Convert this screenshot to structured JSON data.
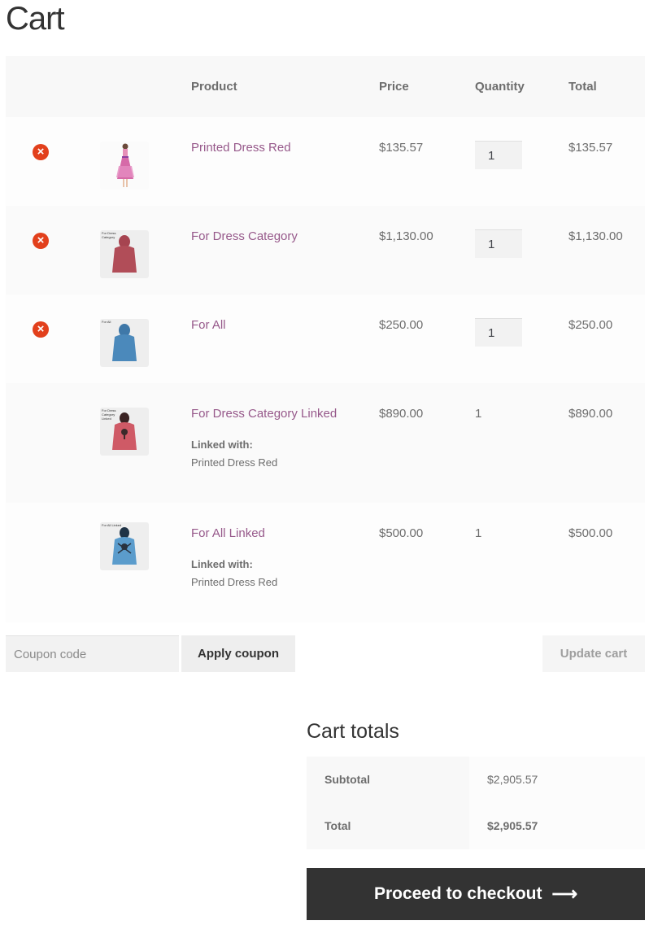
{
  "page": {
    "title": "Cart"
  },
  "colors": {
    "link": "#96588a",
    "remove": "#e2401c",
    "checkout_bg": "#333333"
  },
  "table": {
    "headers": {
      "product": "Product",
      "price": "Price",
      "quantity": "Quantity",
      "total": "Total"
    },
    "rows": [
      {
        "name": "Printed Dress Red",
        "price": "$135.57",
        "quantity": "1",
        "total": "$135.57",
        "removable": true,
        "image": "dress-pink",
        "image_label": ""
      },
      {
        "name": "For Dress Category",
        "price": "$1,130.00",
        "quantity": "1",
        "total": "$1,130.00",
        "removable": true,
        "image": "hoodie-red-back",
        "image_label": "For Dress Category"
      },
      {
        "name": "For All",
        "price": "$250.00",
        "quantity": "1",
        "total": "$250.00",
        "removable": true,
        "image": "hoodie-blue-back",
        "image_label": "For All"
      },
      {
        "name": "For Dress Category Linked",
        "price": "$890.00",
        "quantity": "1",
        "total": "$890.00",
        "removable": false,
        "image": "hoodie-red-front",
        "image_label": "For Dress Category Linked",
        "linked_label": "Linked with:",
        "linked_value": "Printed Dress Red"
      },
      {
        "name": "For All Linked",
        "price": "$500.00",
        "quantity": "1",
        "total": "$500.00",
        "removable": false,
        "image": "hoodie-blue-front",
        "image_label": "For All Linked",
        "linked_label": "Linked with:",
        "linked_value": "Printed Dress Red"
      }
    ]
  },
  "actions": {
    "coupon_placeholder": "Coupon code",
    "apply_coupon": "Apply coupon",
    "update_cart": "Update cart"
  },
  "totals": {
    "title": "Cart totals",
    "subtotal_label": "Subtotal",
    "subtotal_value": "$2,905.57",
    "total_label": "Total",
    "total_value": "$2,905.57",
    "checkout_label": "Proceed to checkout",
    "checkout_arrow": "⟶"
  },
  "icons": {
    "remove": "×"
  }
}
